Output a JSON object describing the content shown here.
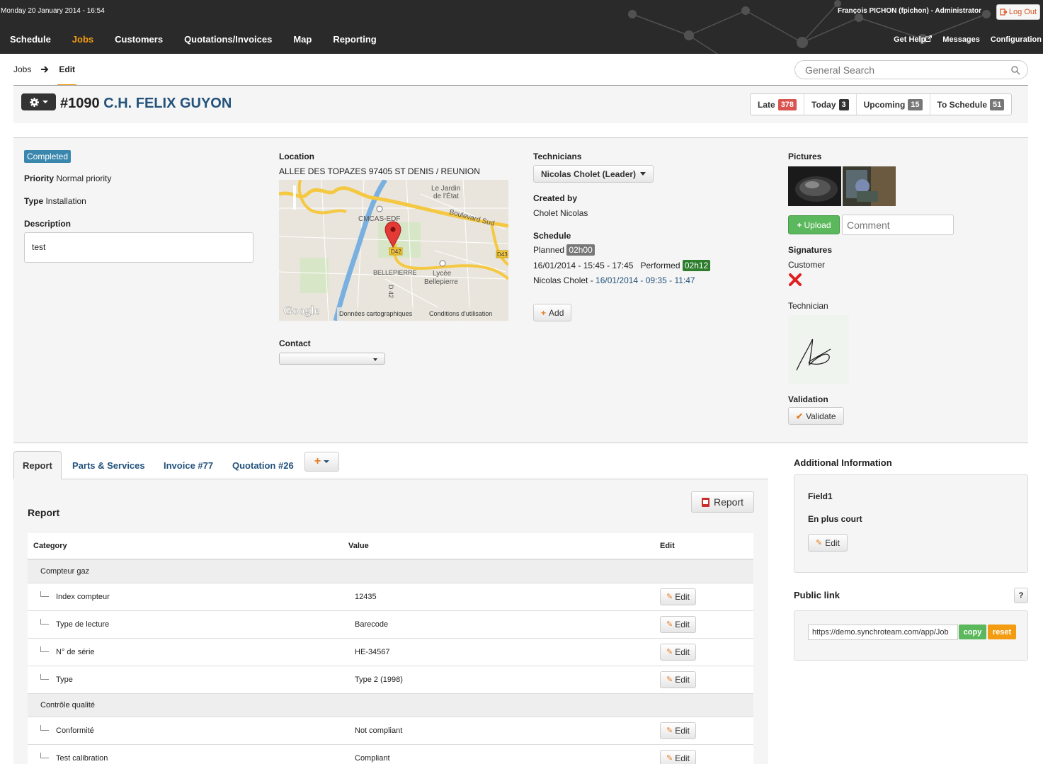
{
  "topbar": {
    "datetime": "Monday 20 January 2014 - 16:54",
    "user": "François PICHON (fpichon) - Administrator",
    "logout": "Log Out",
    "nav": [
      "Schedule",
      "Jobs",
      "Customers",
      "Quotations/Invoices",
      "Map",
      "Reporting"
    ],
    "nav_active": "Jobs",
    "nav_right": [
      "Get Help",
      "Messages",
      "Configuration"
    ]
  },
  "breadcrumb": {
    "root": "Jobs",
    "current": "Edit"
  },
  "search": {
    "placeholder": "General Search"
  },
  "job": {
    "number": "#1090",
    "name": "C.H. FELIX GUYON",
    "status": "Completed",
    "priority_label": "Priority",
    "priority": "Normal priority",
    "type_label": "Type",
    "type": "Installation",
    "description_label": "Description",
    "description": "test"
  },
  "counters": [
    {
      "label": "Late",
      "count": "378"
    },
    {
      "label": "Today",
      "count": "3"
    },
    {
      "label": "Upcoming",
      "count": "15"
    },
    {
      "label": "To Schedule",
      "count": "51"
    }
  ],
  "location": {
    "label": "Location",
    "address": "ALLEE DES TOPAZES 97405 ST DENIS / REUNION",
    "map_labels": {
      "jardin": "Le Jardin\nde l'État",
      "boulevard": "Boulevard Sud",
      "cmcas": "CMCAS-EDF",
      "bellepierre": "BELLEPIERRE",
      "lycee": "Lycée\nBellepierre",
      "d42": "D42",
      "d43": "D43",
      "d42v": "D 42",
      "google": "Google",
      "donnees": "Données cartographiques",
      "conditions": "Conditions d'utilisation"
    }
  },
  "contact": {
    "label": "Contact"
  },
  "technicians": {
    "label": "Technicians",
    "selected": "Nicolas Cholet (Leader)",
    "created_by_label": "Created by",
    "created_by": "Cholet Nicolas",
    "schedule_label": "Schedule",
    "planned_label": "Planned",
    "planned": "02h00",
    "slot": "16/01/2014 - 15:45 - 17:45",
    "performed_label": "Performed",
    "performed": "02h12",
    "tech_name": "Nicolas Cholet - ",
    "tech_slot": "16/01/2014 - 09:35 - 11:47",
    "add": "Add"
  },
  "pictures": {
    "label": "Pictures",
    "upload": "Upload",
    "comment_placeholder": "Comment",
    "signatures_label": "Signatures",
    "customer_label": "Customer",
    "technician_label": "Technician",
    "validation_label": "Validation",
    "validate": "Validate"
  },
  "tabs": [
    "Report",
    "Parts & Services",
    "Invoice #77",
    "Quotation #26"
  ],
  "report": {
    "title": "Report",
    "button": "Report",
    "columns": [
      "Category",
      "Value",
      "Edit"
    ],
    "edit_label": "Edit",
    "categories": [
      {
        "name": "Compteur gaz",
        "rows": [
          {
            "name": "Index compteur",
            "value": "12435"
          },
          {
            "name": "Type de lecture",
            "value": "Barecode"
          },
          {
            "name": "N° de série",
            "value": "HE-34567"
          },
          {
            "name": "Type",
            "value": "Type 2 (1998)"
          }
        ]
      },
      {
        "name": "Contrôle qualité",
        "rows": [
          {
            "name": "Conformité",
            "value": "Not compliant"
          },
          {
            "name": "Test calibration",
            "value": "Compliant"
          }
        ]
      }
    ]
  },
  "sidebar": {
    "additional_title": "Additional Information",
    "field1_label": "Field1",
    "field1_value": "En plus court",
    "edit": "Edit",
    "public_link_title": "Public link",
    "help": "?",
    "url": "https://demo.synchroteam.com/app/Job",
    "copy": "copy",
    "reset": "reset"
  },
  "colors": {
    "accent": "#f39c12",
    "link": "#23527c",
    "late": "#d9534f",
    "success": "#5cb85c",
    "status": "#3a87ad"
  }
}
